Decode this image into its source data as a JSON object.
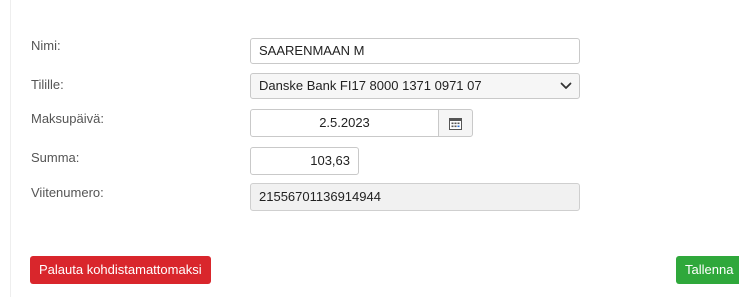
{
  "form": {
    "name": {
      "label": "Nimi:",
      "value": "SAARENMAAN M"
    },
    "account": {
      "label": "Tilille:",
      "selected": "Danske Bank FI17 8000 1371 0971 07"
    },
    "payment_date": {
      "label": "Maksupäivä:",
      "value": "2.5.2023"
    },
    "amount": {
      "label": "Summa:",
      "value": "103,63"
    },
    "reference": {
      "label": "Viitenumero:",
      "value": "21556701136914944"
    }
  },
  "actions": {
    "revert_label": "Palauta kohdistamattomaksi",
    "save_label": "Tallenna"
  },
  "colors": {
    "danger": "#d9262c",
    "success": "#2fa83b"
  },
  "icons": {
    "account_dropdown": "chevron-down-icon",
    "date_picker": "calendar-icon"
  }
}
